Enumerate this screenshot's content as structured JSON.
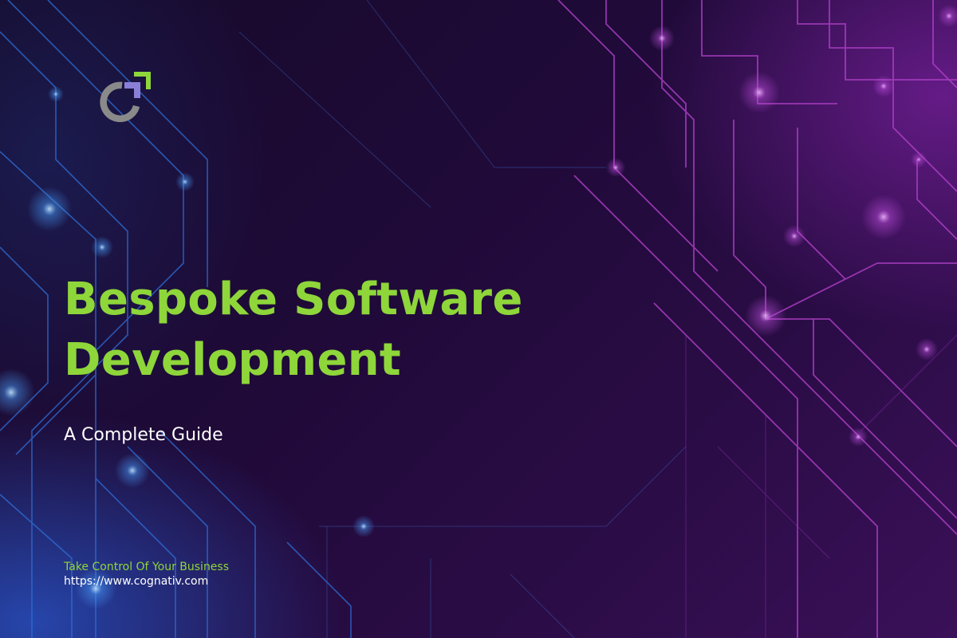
{
  "hero": {
    "title_line1": "Bespoke Software",
    "title_line2": "Development",
    "subtitle": "A Complete Guide"
  },
  "footer": {
    "tagline": "Take Control Of Your Business",
    "website": "https://www.cognativ.com"
  },
  "colors": {
    "accent_green": "#8ed63a",
    "logo_purple": "#8a7fd6",
    "logo_gray": "#8a8a8a",
    "circuit_blue": "#2f6fd8",
    "circuit_purple": "#b040c8"
  },
  "logo": {
    "icon": "cognativ-logo-icon"
  }
}
